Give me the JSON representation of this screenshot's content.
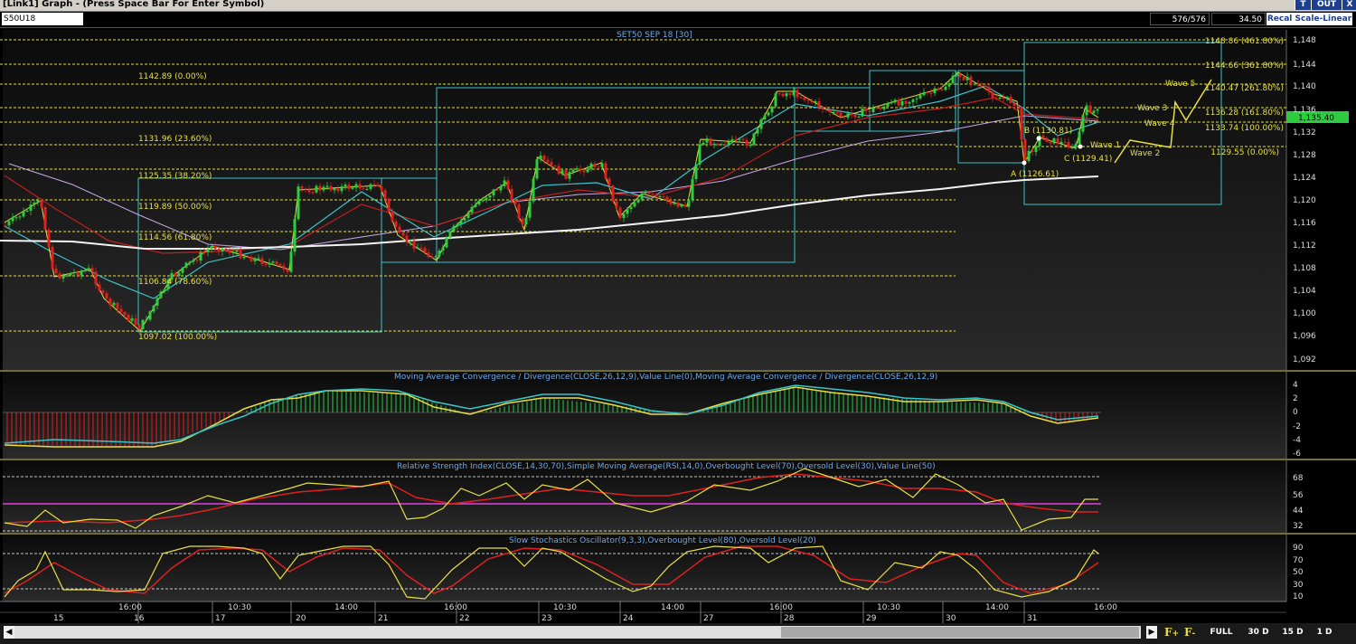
{
  "window": {
    "title": "[Link1] Graph - (Press Space Bar For Enter Symbol)",
    "buttons": [
      "T",
      "OUT",
      "X"
    ]
  },
  "toolbar": {
    "symbol": "S50U18",
    "bar_count": "576/576",
    "value": "34.50",
    "scale_button": "Recal Scale-Linear"
  },
  "price_panel": {
    "title": "SET50 SEP 18 [30]",
    "last_price": "1,135.40",
    "fib_left": [
      "1142.89 (0.00%)",
      "1131.96 (23.60%)",
      "1125.35 (38.20%)",
      "1119.89 (50.00%)",
      "1114.56 (61.80%)",
      "1106.84 (78.60%)",
      "1097.02 (100.00%)"
    ],
    "fib_right": [
      "1148.86 (461.80%)",
      "1144.66 (361.80%)",
      "1140.47 (261.80%)",
      "1136.28 (161.80%)",
      "1133.74 (100.00%)",
      "1129.55 (0.00%)"
    ],
    "wave_labels": [
      "Wave 5",
      "Wave 3",
      "Wave 4",
      "Wave 1",
      "Wave 2"
    ],
    "abc_labels": [
      "A (1126.61)",
      "B (1130.81)",
      "C (1129.41)"
    ],
    "yaxis": [
      "1,148",
      "1,144",
      "1,140",
      "1,136",
      "1,132",
      "1,128",
      "1,124",
      "1,120",
      "1,116",
      "1,112",
      "1,108",
      "1,104",
      "1,100",
      "1,096",
      "1,092"
    ]
  },
  "macd_panel": {
    "title": "Moving Average Convergence / Divergence(CLOSE,26,12,9),Value Line(0),Moving Average Convergence / Divergence(CLOSE,26,12,9)",
    "yaxis": [
      "4",
      "2",
      "0",
      "-2",
      "-4",
      "-6"
    ]
  },
  "rsi_panel": {
    "title": "Relative Strength Index(CLOSE,14,30,70),Simple Moving Average(RSI,14,0),Overbought Level(70),Oversold Level(30),Value Line(50)",
    "yaxis": [
      "68",
      "56",
      "44",
      "32"
    ]
  },
  "stoch_panel": {
    "title": "Slow Stochastics Oscillator(9,3,3),Overbought Level(80),Oversold Level(20)",
    "yaxis": [
      "90",
      "70",
      "50",
      "30",
      "10"
    ]
  },
  "time_axis": {
    "times": [
      "16:00",
      "10:30",
      "14:00",
      "16:00",
      "10:30",
      "14:00",
      "16:00",
      "10:30",
      "14:00",
      "16:00"
    ],
    "days": [
      "15",
      "16",
      "17",
      "20",
      "21",
      "22",
      "23",
      "24",
      "27",
      "28",
      "29",
      "30",
      "31"
    ]
  },
  "bottom": {
    "full": "FULL",
    "p30": "30 D",
    "p15": "15 D",
    "p1": "1 D",
    "f1": "F",
    "f2": "F"
  },
  "colors": {
    "up": "#2ecc40",
    "down": "#e02020",
    "fib": "#e8e040",
    "box": "#39c5c8",
    "macd_signal": "#e8e040",
    "macd_line": "#39c5c8"
  }
}
